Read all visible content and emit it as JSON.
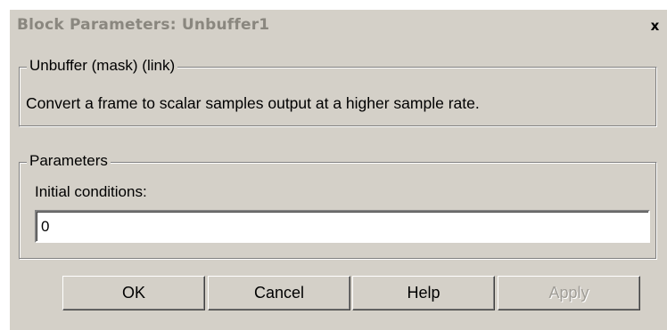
{
  "window": {
    "title": "Block Parameters: Unbuffer1",
    "close_glyph": "x"
  },
  "description_group": {
    "legend": "Unbuffer (mask) (link)",
    "text": "Convert a frame to scalar samples output at a higher sample rate."
  },
  "parameters_group": {
    "legend": "Parameters",
    "initial_conditions_label": "Initial conditions:",
    "initial_conditions_value": "0"
  },
  "buttons": {
    "ok": "OK",
    "cancel": "Cancel",
    "help": "Help",
    "apply": "Apply"
  },
  "colors": {
    "dialog_face": "#d4d0c8",
    "title_text": "#8a877f",
    "disabled_text": "#a09d97"
  }
}
